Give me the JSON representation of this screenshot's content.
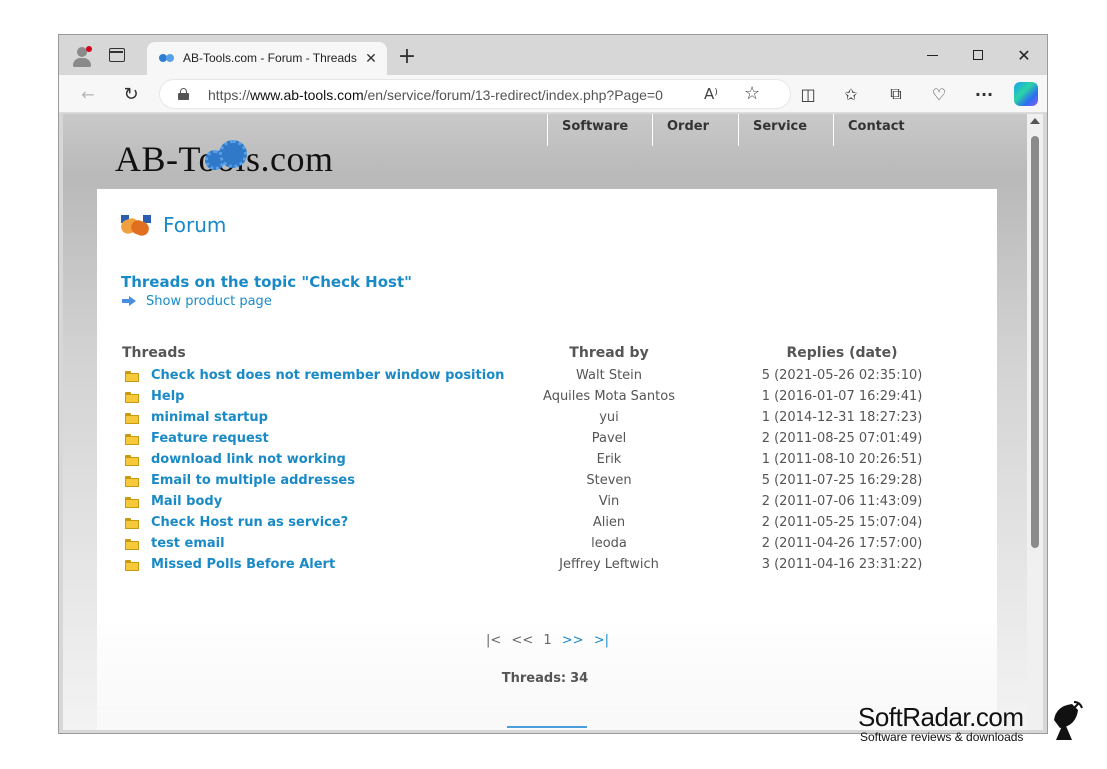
{
  "browser": {
    "tab_title": "AB-Tools.com - Forum - Threads",
    "tab_close": "✕",
    "new_tab": "+",
    "win_close": "✕",
    "url_prefix": "https://",
    "url_domain": "www.ab-tools.com",
    "url_path": "/en/service/forum/13-redirect/index.php?Page=0",
    "read_aloud": "A⁾",
    "favorite_star": "☆",
    "back": "←",
    "reload": "↻",
    "more": "···",
    "split_screen": "◫",
    "favorites": "✩",
    "collections": "⧉",
    "health": "♡"
  },
  "site": {
    "logo": "AB-Tools.com",
    "nav": [
      "Software",
      "Order",
      "Service",
      "Contact"
    ]
  },
  "forum": {
    "title": "Forum",
    "topic_title": "Threads on the topic \"Check Host\"",
    "product_link": "Show product page",
    "headers": {
      "threads": "Threads",
      "thread_by": "Thread by",
      "replies": "Replies (date)"
    },
    "threads": [
      {
        "title": "Check host does not remember window position",
        "by": "Walt Stein",
        "replies": "5 (2021-05-26 02:35:10)"
      },
      {
        "title": "Help",
        "by": "Aquiles Mota Santos",
        "replies": "1 (2016-01-07 16:29:41)"
      },
      {
        "title": "minimal startup",
        "by": "yui",
        "replies": "1 (2014-12-31 18:27:23)"
      },
      {
        "title": "Feature request",
        "by": "Pavel",
        "replies": "2 (2011-08-25 07:01:49)"
      },
      {
        "title": "download link not working",
        "by": "Erik",
        "replies": "1 (2011-08-10 20:26:51)"
      },
      {
        "title": "Email to multiple addresses",
        "by": "Steven",
        "replies": "5 (2011-07-25 16:29:28)"
      },
      {
        "title": "Mail body",
        "by": "Vin",
        "replies": "2 (2011-07-06 11:43:09)"
      },
      {
        "title": "Check Host run as service?",
        "by": "Alien",
        "replies": "2 (2011-05-25 15:07:04)"
      },
      {
        "title": "test email",
        "by": "leoda",
        "replies": "2 (2011-04-26 17:57:00)"
      },
      {
        "title": "Missed Polls Before Alert",
        "by": "Jeffrey Leftwich",
        "replies": "3 (2011-04-16 23:31:22)"
      }
    ],
    "pager": {
      "first": "|<",
      "prev": "<<",
      "current": "1",
      "next": ">>",
      "last": ">|"
    },
    "thread_count_label": "Threads:",
    "thread_count": "34"
  },
  "watermark": {
    "name": "SoftRadar.com",
    "tagline": "Software reviews & downloads"
  },
  "colors": {
    "link": "#1a8ac7",
    "text": "#555555",
    "folder": "#f5c93a"
  }
}
